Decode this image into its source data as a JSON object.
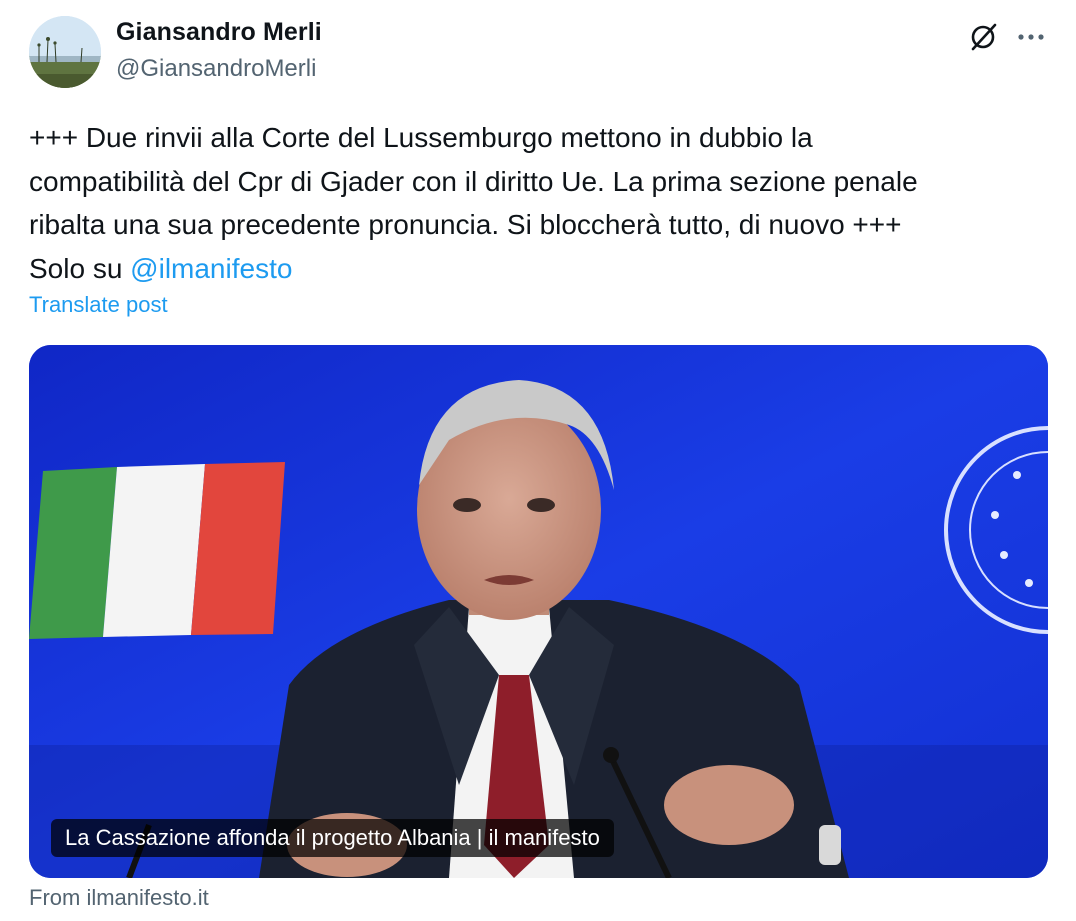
{
  "author": {
    "display_name": "Giansandro Merli",
    "handle": "@GiansandroMerli",
    "avatar_icon": "avatar-photo-landscape"
  },
  "header_actions": {
    "grok_icon": "grok-icon",
    "more_icon": "more-options-icon"
  },
  "post": {
    "lines": [
      "+++ Due rinvii alla Corte del Lussemburgo mettono in dubbio la",
      "compatibilità del Cpr di Gjader con il diritto Ue. La prima sezione penale",
      "ribalta una sua precedente pronuncia. Si bloccherà tutto, di nuovo +++"
    ],
    "last_line_prefix": "Solo su ",
    "mention": "@ilmanifesto",
    "translate_label": "Translate post"
  },
  "link_card": {
    "caption": "La Cassazione affonda il progetto Albania | il manifesto",
    "source": "From ilmanifesto.it"
  },
  "colors": {
    "link": "#1d9bf0",
    "secondary_text": "#536471",
    "primary_text": "#0f1419",
    "card_background": "#1431d8"
  }
}
